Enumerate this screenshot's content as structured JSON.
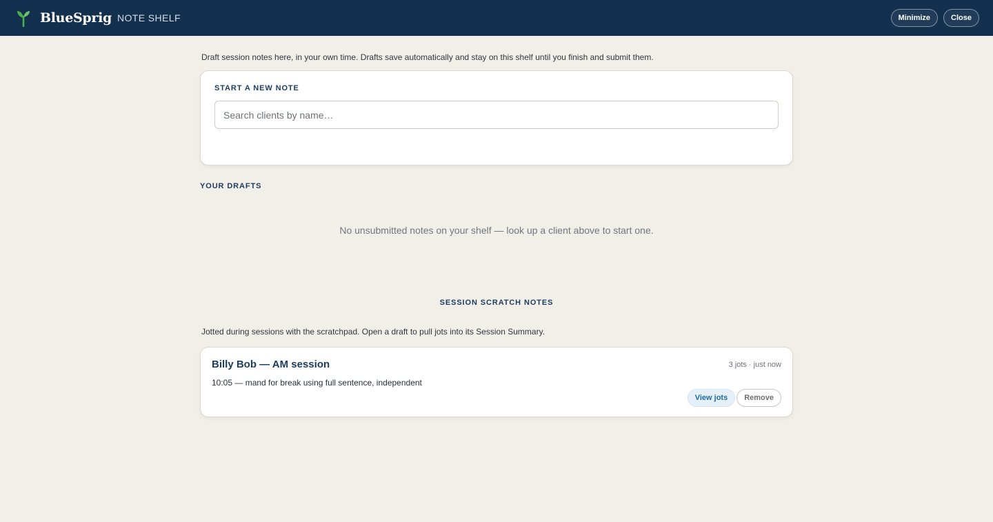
{
  "app": {
    "brand": "BlueSprig",
    "subtitle": "NOTE SHELF",
    "logo_icon": "sprout-icon",
    "accent": "#13304f",
    "logo_color": "#4caf50"
  },
  "window_actions": {
    "minimize_label": "Minimize",
    "close_label": "Close"
  },
  "intro_text": "Draft session notes here, in your own time. Drafts save automatically and stay on this shelf until you finish and submit them.",
  "new_note": {
    "heading": "START A NEW NOTE",
    "search_placeholder": "Search clients by name…",
    "search_value": ""
  },
  "drafts": {
    "heading": "YOUR DRAFTS",
    "empty_text": "No unsubmitted notes on your shelf — look up a client above to start one."
  },
  "scratch": {
    "heading": "SESSION SCRATCH NOTES",
    "description": "Jotted during sessions with the scratchpad. Open a draft to pull jots into its Session Summary.",
    "items": [
      {
        "title": "Billy Bob — AM session",
        "meta": "3 jots · just now",
        "preview": "10:05 — mand for break using full sentence, independent",
        "view_label": "View jots",
        "remove_label": "Remove"
      }
    ]
  }
}
